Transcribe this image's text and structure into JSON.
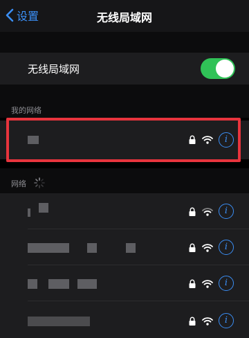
{
  "navbar": {
    "back_label": "设置",
    "title": "无线局域网"
  },
  "wifi_toggle": {
    "label": "无线局域网",
    "on": true
  },
  "my_networks": {
    "header": "我的网络"
  },
  "networks": {
    "header": "网络"
  },
  "colors": {
    "accent": "#3b8ff6",
    "switch_on": "#30c257",
    "highlight": "#e8343d"
  },
  "icons": {
    "back": "chevron-left-icon",
    "lock": "lock-icon",
    "wifi": "wifi-icon",
    "info": "info-icon",
    "spinner": "spinner-icon"
  }
}
